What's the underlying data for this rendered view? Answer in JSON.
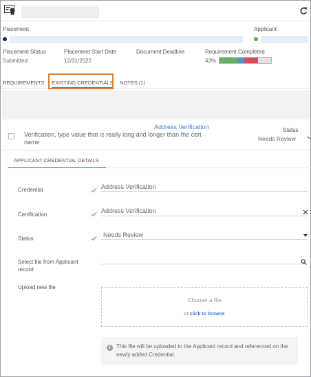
{
  "header": {
    "icon": "credential-badge-icon",
    "refresh_icon": "refresh-icon"
  },
  "placement": {
    "placement_label": "Placement",
    "applicant_label": "Applicant",
    "placement_dot_color": "#1f2a44",
    "applicant_dot_color": "#43b65a"
  },
  "summary": {
    "status_label": "Placement Status",
    "status_value": "Submitted",
    "start_label": "Placement Start Date",
    "start_value": "12/31/2022",
    "deadline_label": "Document Deadline",
    "requirement_label": "Requirement Completed",
    "requirement_value": "43%",
    "progress": [
      {
        "fraction": 0.36,
        "color": "#5fb35b"
      },
      {
        "fraction": 0.12,
        "color": "#4f8fdc"
      },
      {
        "fraction": 0.26,
        "color": "#d94b5c"
      },
      {
        "fraction": 0.26,
        "color": "#e3e3e3"
      }
    ]
  },
  "tabs": [
    {
      "label": "REQUIREMENTS"
    },
    {
      "label": "EXISTING CREDENTIALS"
    },
    {
      "label": "NOTES (1)"
    }
  ],
  "credential": {
    "link": "Address Verification",
    "description": "Verification, type value that is really long and longer than the cert name",
    "status_label": "Status",
    "status_value": "Needs Review"
  },
  "details": {
    "tab_label": "APPLICANT CREDENTIAL DETAILS",
    "credential_label": "Credential",
    "credential_value": "Address Verification",
    "certification_label": "Certification",
    "certification_value": "Address Verification",
    "status_label": "Status",
    "status_value": "Needs Review",
    "select_file_label": "Select file from Applicant record",
    "upload_label": "Upload new file",
    "drop_title": "Choose a file",
    "drop_or": "or",
    "drop_browse": "click to browse",
    "info_text": "This file will be uploaded to the Applicant record and referenced on the newly added Credential."
  },
  "colors": {
    "accent": "#3f7bd5",
    "highlight": "#e27f2d",
    "check": "#5cb85c"
  }
}
